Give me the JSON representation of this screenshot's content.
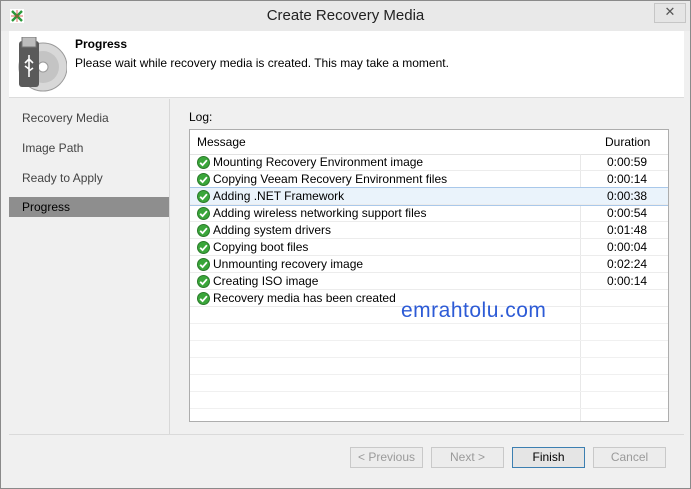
{
  "window": {
    "title": "Create Recovery Media",
    "close_glyph": "✕"
  },
  "header": {
    "title": "Progress",
    "description": "Please wait while recovery media is created. This may take a moment.",
    "icon": "usb-disc-icon"
  },
  "sidebar": {
    "items": [
      {
        "label": "Recovery Media",
        "active": false
      },
      {
        "label": "Image Path",
        "active": false
      },
      {
        "label": "Ready to Apply",
        "active": false
      },
      {
        "label": "Progress",
        "active": true
      }
    ]
  },
  "log": {
    "label": "Log:",
    "columns": {
      "message": "Message",
      "duration": "Duration"
    },
    "rows": [
      {
        "message": "Mounting Recovery Environment image",
        "duration": "0:00:59",
        "status": "success"
      },
      {
        "message": "Copying Veeam Recovery Environment files",
        "duration": "0:00:14",
        "status": "success"
      },
      {
        "message": "Adding .NET Framework",
        "duration": "0:00:38",
        "status": "success",
        "selected": true
      },
      {
        "message": "Adding wireless networking support files",
        "duration": "0:00:54",
        "status": "success"
      },
      {
        "message": "Adding system drivers",
        "duration": "0:01:48",
        "status": "success"
      },
      {
        "message": "Copying boot files",
        "duration": "0:00:04",
        "status": "success"
      },
      {
        "message": "Unmounting recovery image",
        "duration": "0:02:24",
        "status": "success"
      },
      {
        "message": "Creating ISO image",
        "duration": "0:00:14",
        "status": "success"
      },
      {
        "message": "Recovery media has been created",
        "duration": "",
        "status": "success"
      }
    ]
  },
  "watermark": "emrahtolu.com",
  "buttons": {
    "previous": "< Previous",
    "next": "Next >",
    "finish": "Finish",
    "cancel": "Cancel"
  },
  "colors": {
    "accent": "#3c7fb1",
    "success": "#3aa63a",
    "selected_row": "#eaf3fb",
    "watermark": "#2d5bd6"
  }
}
